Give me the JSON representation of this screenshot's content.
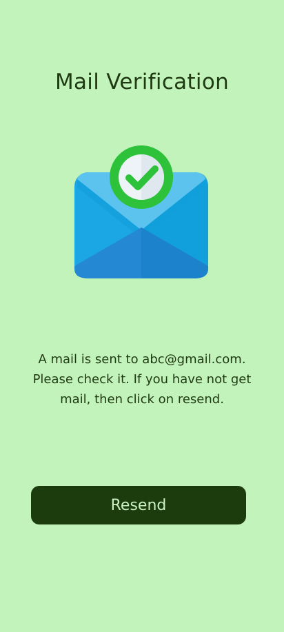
{
  "page": {
    "title": "Mail Verification",
    "message": "A mail is sent to abc@gmail.com. Please check it. If you have not get mail, then click on resend.",
    "resend_label": "Resend"
  },
  "illustration": {
    "icon": "mail-verified-icon",
    "check_icon": "checkmark-icon"
  },
  "colors": {
    "background": "#c2f3bb",
    "button": "#1c3c0e",
    "button_text": "#c9f1c0",
    "text": "#1f3a12",
    "envelope_blue": "#1ba6e4",
    "check_green": "#2dc23a"
  }
}
